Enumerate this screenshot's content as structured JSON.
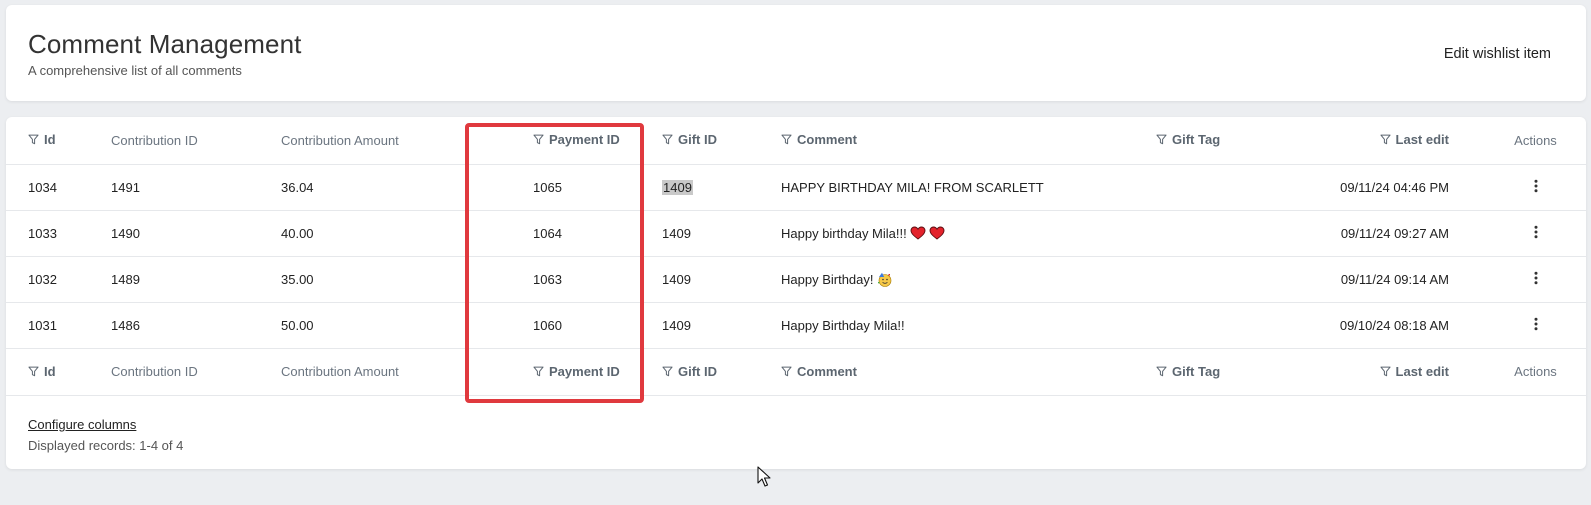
{
  "header": {
    "title": "Comment Management",
    "subtitle": "A comprehensive list of all comments",
    "action_label": "Edit wishlist item"
  },
  "table": {
    "columns": [
      {
        "key": "id",
        "label": "Id",
        "filterable": true
      },
      {
        "key": "contribution_id",
        "label": "Contribution ID",
        "filterable": false
      },
      {
        "key": "contribution_amount",
        "label": "Contribution Amount",
        "filterable": false
      },
      {
        "key": "payment_id",
        "label": "Payment ID",
        "filterable": true
      },
      {
        "key": "gift_id",
        "label": "Gift ID",
        "filterable": true
      },
      {
        "key": "comment",
        "label": "Comment",
        "filterable": true
      },
      {
        "key": "gift_tag",
        "label": "Gift Tag",
        "filterable": true
      },
      {
        "key": "last_edit",
        "label": "Last edit",
        "filterable": true
      },
      {
        "key": "actions",
        "label": "Actions",
        "filterable": false
      }
    ],
    "rows": [
      {
        "id": "1034",
        "contribution_id": "1491",
        "contribution_amount": "36.04",
        "payment_id": "1065",
        "gift_id": "1409",
        "comment": "HAPPY BIRTHDAY MILA! FROM SCARLETT",
        "comment_emoji": "",
        "gift_tag": "",
        "last_edit": "09/11/24 04:46 PM",
        "gift_id_selected": true
      },
      {
        "id": "1033",
        "contribution_id": "1490",
        "contribution_amount": "40.00",
        "payment_id": "1064",
        "gift_id": "1409",
        "comment": "Happy birthday Mila!!!",
        "comment_emoji": "red-heart-red-heart",
        "gift_tag": "",
        "last_edit": "09/11/24 09:27 AM",
        "gift_id_selected": false
      },
      {
        "id": "1032",
        "contribution_id": "1489",
        "contribution_amount": "35.00",
        "payment_id": "1063",
        "gift_id": "1409",
        "comment": "Happy Birthday!",
        "comment_emoji": "partying-face",
        "gift_tag": "",
        "last_edit": "09/11/24 09:14 AM",
        "gift_id_selected": false
      },
      {
        "id": "1031",
        "contribution_id": "1486",
        "contribution_amount": "50.00",
        "payment_id": "1060",
        "gift_id": "1409",
        "comment": "Happy Birthday Mila!!",
        "comment_emoji": "",
        "gift_tag": "",
        "last_edit": "09/10/24 08:18 AM",
        "gift_id_selected": false
      }
    ]
  },
  "footer": {
    "configure_label": "Configure columns",
    "records_label": "Displayed records: 1-4 of 4"
  },
  "colors": {
    "highlight": "#e0393e",
    "background": "#eceef1",
    "header_text": "#5c6670"
  },
  "icons": {
    "filter": "filter-icon",
    "actions": "kebab-menu-icon",
    "cursor": "mouse-pointer-icon"
  }
}
